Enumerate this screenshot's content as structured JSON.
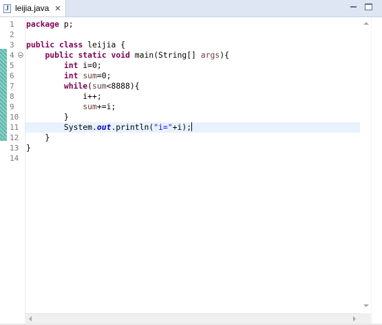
{
  "tab": {
    "icon": "java-file-icon",
    "icon_letter": "J",
    "label": "leijia.java",
    "close_glyph": "✕"
  },
  "window_controls": [
    "minimize-icon",
    "maximize-icon"
  ],
  "line_numbers": [
    "1",
    "2",
    "3",
    "4",
    "5",
    "6",
    "7",
    "8",
    "9",
    "10",
    "11",
    "12",
    "13",
    "14"
  ],
  "code_lines": [
    "package p;",
    "",
    "public class leijia {",
    "    public static void main(String[] args){",
    "        int i=0;",
    "        int sum=0;",
    "        while(sum<8888){",
    "            i++;",
    "            sum+=i;",
    "        }",
    "        System.out.println(\"i=\"+i);",
    "    }",
    "}",
    ""
  ],
  "current_line": 11,
  "colors": {
    "keyword": "#7f0055",
    "local_variable": "#6a3e3e",
    "static_field": "#0000c0",
    "string": "#2a00ff",
    "current_line_bg": "#e8f2fe",
    "change_bar": "#5fb8aa"
  }
}
